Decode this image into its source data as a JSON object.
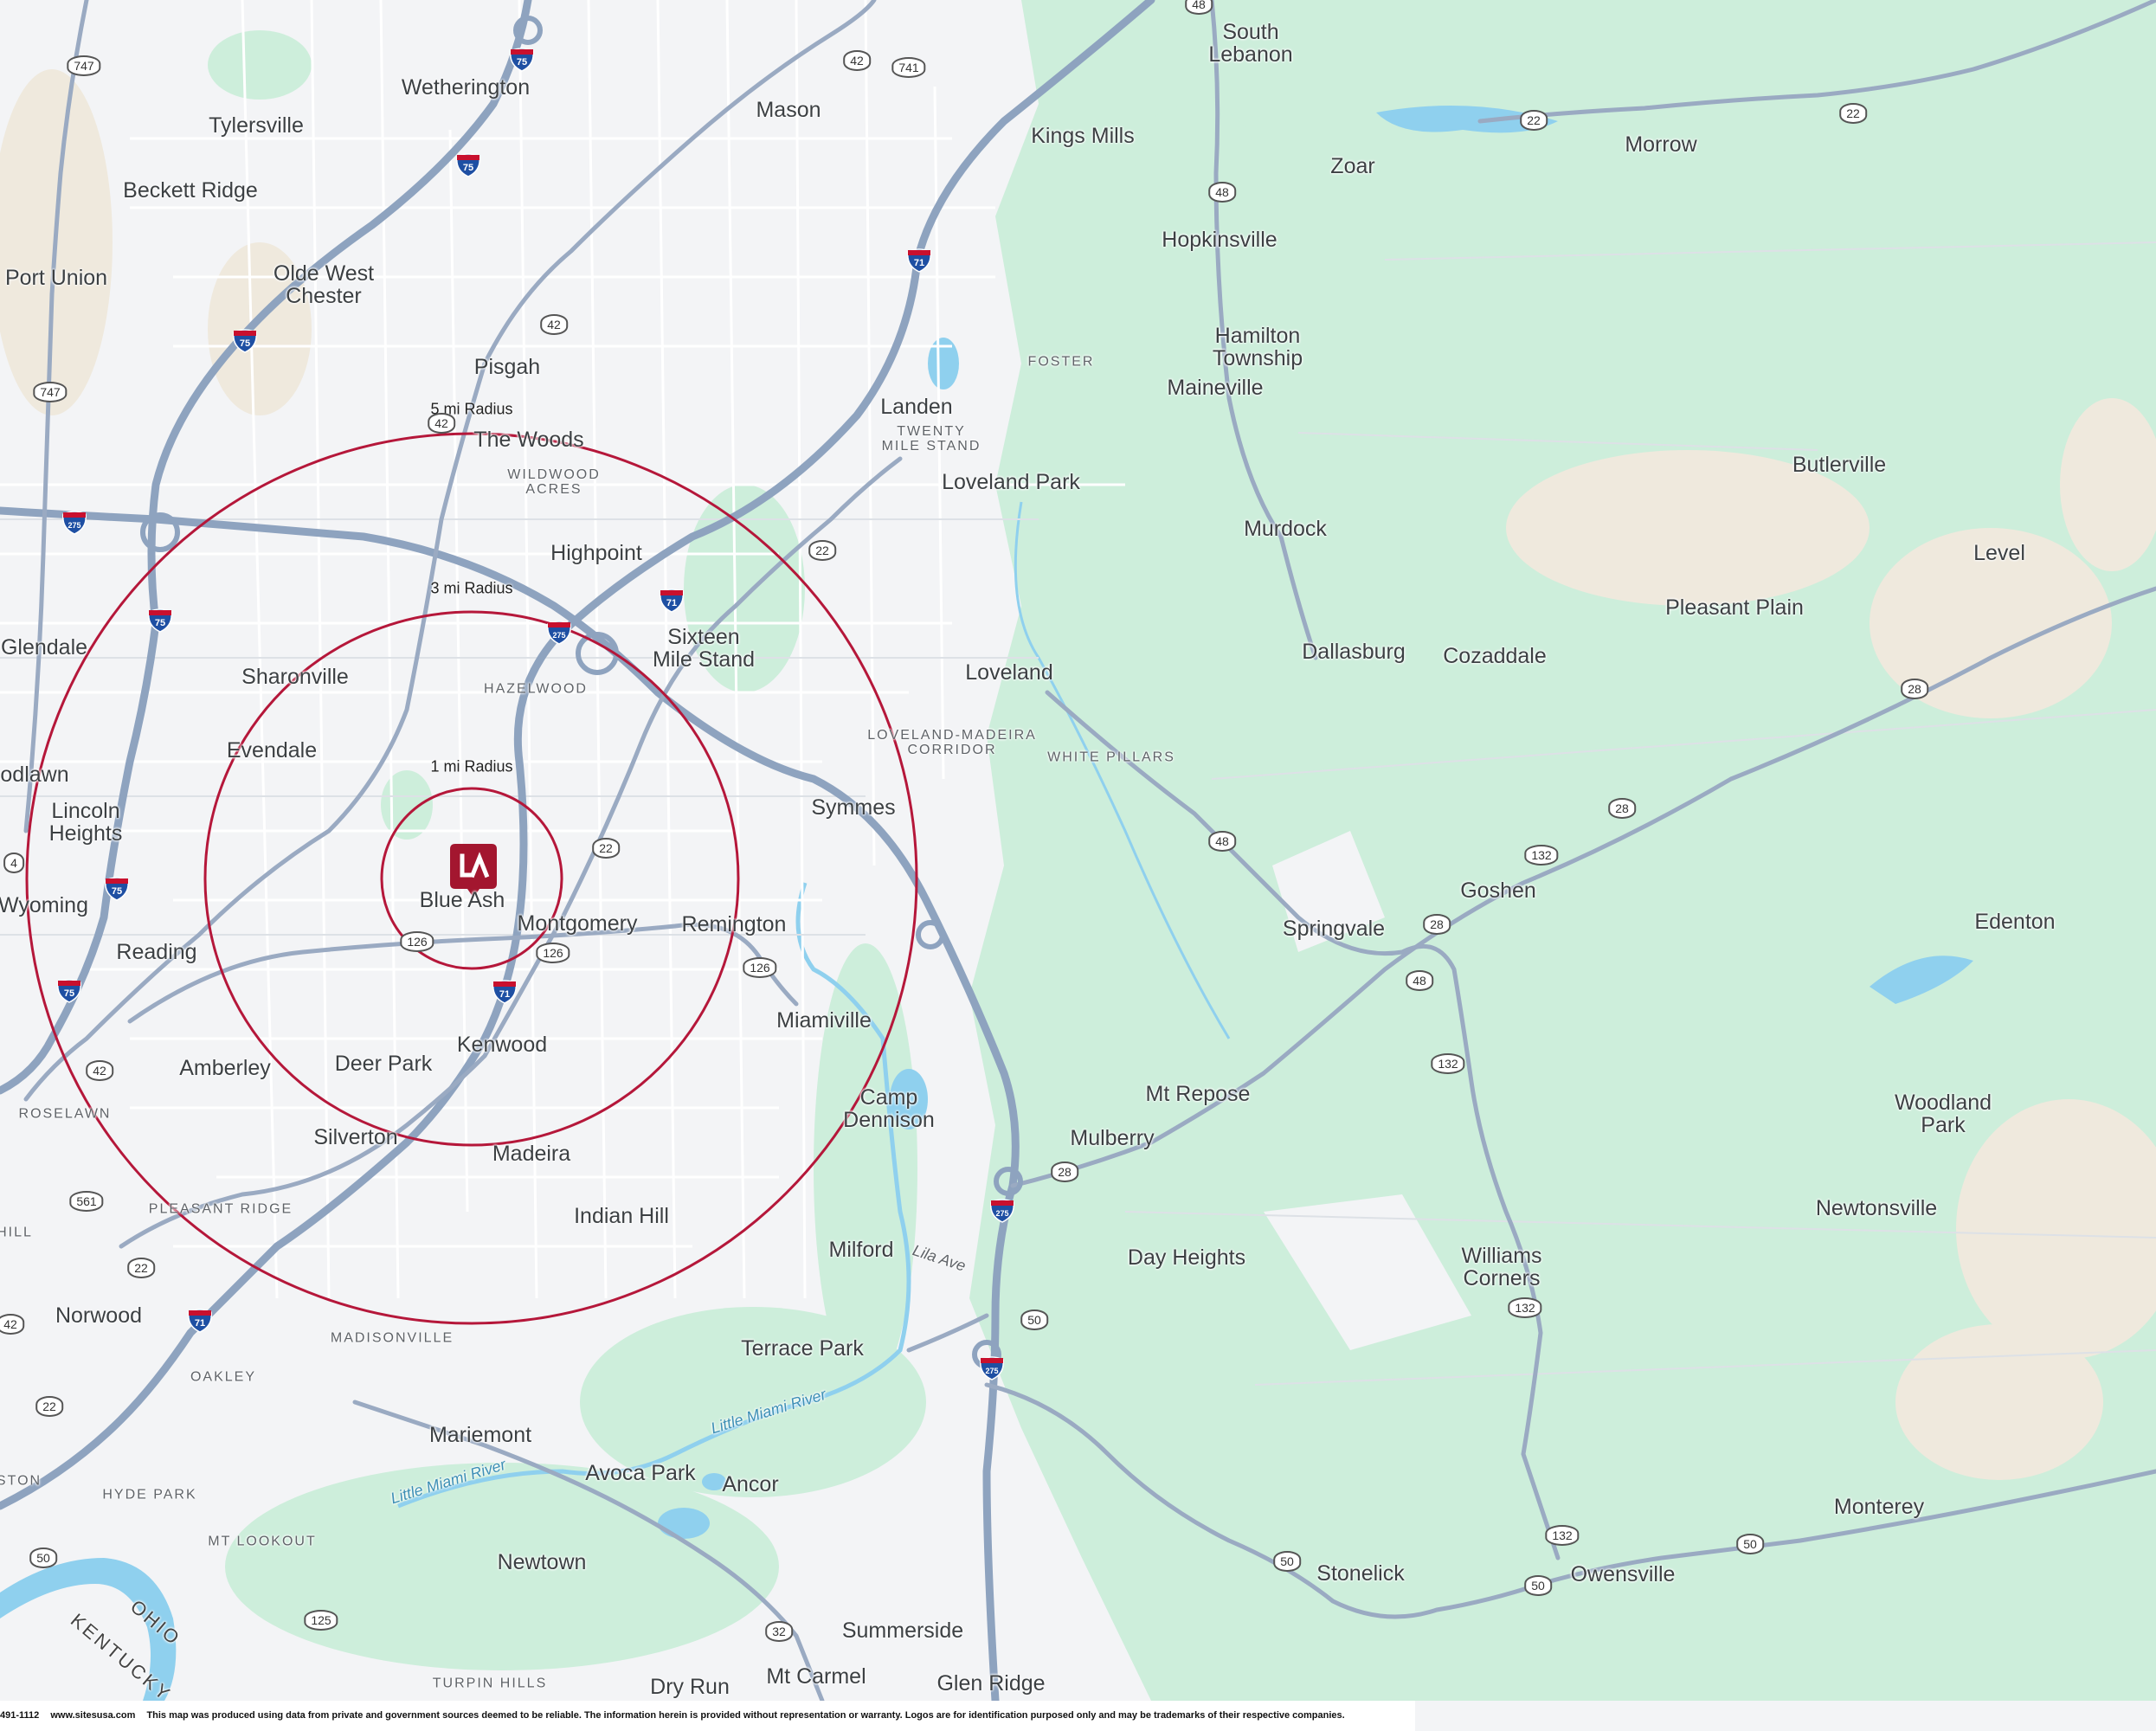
{
  "map": {
    "center_label": "Blue Ash",
    "marker_logo": "company-logo-marker",
    "colors": {
      "land": "#f3f4f6",
      "park": "#c9ecd6",
      "road": "#8ea3bf",
      "water": "#8fd0ee",
      "radius_ring": "#b5173a"
    }
  },
  "radii": [
    {
      "label": "1 mi Radius"
    },
    {
      "label": "3 mi Radius"
    },
    {
      "label": "5 mi Radius"
    }
  ],
  "places": {
    "south_lebanon": "South\nLebanon",
    "wetherington": "Wetherington",
    "mason": "Mason",
    "kings_mills": "Kings Mills",
    "morrow": "Morrow",
    "zoar": "Zoar",
    "tylersville": "Tylersville",
    "beckett_ridge": "Beckett Ridge",
    "hopkinsville": "Hopkinsville",
    "port_union": "Port Union",
    "olde_west_chester": "Olde West\nChester",
    "hamilton_township": "Hamilton\nTownship",
    "maineville": "Maineville",
    "pisgah": "Pisgah",
    "landen": "Landen",
    "the_woods": "The Woods",
    "butlerville": "Butlerville",
    "loveland_park": "Loveland Park",
    "murdock": "Murdock",
    "highpoint": "Highpoint",
    "level": "Level",
    "pleasant_plain": "Pleasant Plain",
    "glendale": "Glendale",
    "sharonville": "Sharonville",
    "sixteen_mile_stand": "Sixteen\nMile Stand",
    "loveland": "Loveland",
    "dallasburg": "Dallasburg",
    "cozaddale": "Cozaddale",
    "evendale": "Evendale",
    "woodlawn": "odlawn",
    "lincoln_heights": "Lincoln\nHeights",
    "symmes": "Symmes",
    "wyoming": "Wyoming",
    "goshen": "Goshen",
    "edenton": "Edenton",
    "blue_ash": "Blue Ash",
    "montgomery": "Montgomery",
    "remington": "Remington",
    "springvale": "Springvale",
    "reading": "Reading",
    "miamiville": "Miamiville",
    "amberley": "Amberley",
    "deer_park": "Deer Park",
    "kenwood": "Kenwood",
    "mt_repose": "Mt Repose",
    "woodland_park": "Woodland\nPark",
    "camp_dennison": "Camp\nDennison",
    "silverton": "Silverton",
    "mulberry": "Mulberry",
    "madeira": "Madeira",
    "indian_hill": "Indian Hill",
    "newtonsville": "Newtonsville",
    "milford": "Milford",
    "day_heights": "Day Heights",
    "williams_corners": "Williams\nCorners",
    "norwood": "Norwood",
    "terrace_park": "Terrace Park",
    "mariemont": "Mariemont",
    "avoca_park": "Avoca Park",
    "ancor": "Ancor",
    "monterey": "Monterey",
    "newtown": "Newtown",
    "stonelick": "Stonelick",
    "owensville": "Owensville",
    "summerside": "Summerside",
    "dry_run": "Dry Run",
    "mt_carmel": "Mt Carmel",
    "glen_ridge": "Glen Ridge"
  },
  "neighborhoods": {
    "foster": "FOSTER",
    "twenty_mile_stand": "TWENTY\nMILE STAND",
    "wildwood_acres": "WILDWOOD\nACRES",
    "hazelwood": "HAZELWOOD",
    "loveland_madeira_corridor": "LOVELAND-MADEIRA\nCORRIDOR",
    "white_pillars": "WHITE PILLARS",
    "roselawn": "ROSELAWN",
    "pleasant_ridge": "PLEASANT RIDGE",
    "madisonville": "MADISONVILLE",
    "oakley": "OAKLEY",
    "hyde_park": "HYDE PARK",
    "mt_lookout": "MT LOOKOUT",
    "turpin_hills": "TURPIN HILLS",
    "hill": "HILL",
    "ston": "STON"
  },
  "water_labels": {
    "little_miami_river_1": "Little Miami River",
    "little_miami_river_2": "Little Miami River",
    "lila_ave": "Lila Ave"
  },
  "state_labels": {
    "ohio": "OHIO",
    "kentucky": "KENTUCKY"
  },
  "shields": {
    "i75": "75",
    "i71": "71",
    "i275": "275",
    "us42": "42",
    "us22": "22",
    "us50": "50",
    "sr48": "48",
    "sr126": "126",
    "sr28": "28",
    "sr132": "132",
    "sr32": "32",
    "sr125": "125",
    "sr561": "561",
    "sr747": "747",
    "sr741": "741",
    "sr4": "4"
  },
  "footer": {
    "phone": "491-1112",
    "website": "www.sitesusa.com",
    "disclaimer": "This map was produced using data from private and government sources deemed to be reliable. The information herein is provided without representation or warranty. Logos are for identification purposed only and may be trademarks of their respective companies."
  }
}
